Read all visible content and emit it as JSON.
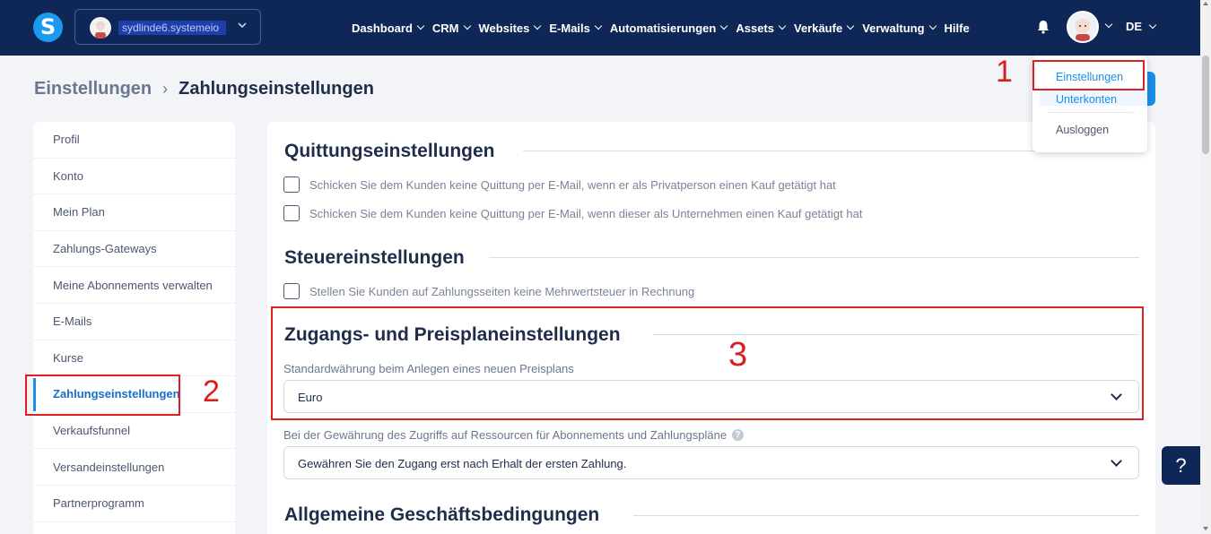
{
  "topbar": {
    "logo_letter": "S",
    "account_name": "sydlinde6.systemeio",
    "nav": [
      {
        "label": "Dashboard"
      },
      {
        "label": "CRM"
      },
      {
        "label": "Websites"
      },
      {
        "label": "E-Mails"
      },
      {
        "label": "Automatisierungen"
      },
      {
        "label": "Assets"
      },
      {
        "label": "Verkäufe"
      },
      {
        "label": "Verwaltung"
      }
    ],
    "help_label": "Hilfe",
    "language": "DE"
  },
  "user_menu": {
    "items": [
      "Einstellungen",
      "Unterkonten",
      "Ausloggen"
    ]
  },
  "breadcrumb": {
    "parent": "Einstellungen",
    "separator": "›",
    "current": "Zahlungseinstellungen"
  },
  "sidebar": {
    "items": [
      "Profil",
      "Konto",
      "Mein Plan",
      "Zahlungs-Gateways",
      "Meine Abonnements verwalten",
      "E-Mails",
      "Kurse",
      "Zahlungseinstellungen",
      "Verkaufsfunnel",
      "Versandeinstellungen",
      "Partnerprogramm"
    ],
    "active_index": 7
  },
  "main": {
    "receipt": {
      "title": "Quittungseinstellungen",
      "option1": "Schicken Sie dem Kunden keine Quittung per E-Mail, wenn er als Privatperson einen Kauf getätigt hat",
      "option2": "Schicken Sie dem Kunden keine Quittung per E-Mail, wenn dieser als Unternehmen einen Kauf getätigt hat"
    },
    "tax": {
      "title": "Steuereinstellungen",
      "option1": "Stellen Sie Kunden auf Zahlungsseiten keine Mehrwertsteuer in Rechnung"
    },
    "access": {
      "title": "Zugangs- und Preisplaneinstellungen",
      "currency_label": "Standardwährung beim Anlegen eines neuen Preisplans",
      "currency_value": "Euro",
      "access_label": "Bei der Gewährung des Zugriffs auf Ressourcen für Abonnements und Zahlungspläne",
      "access_value": "Gewähren Sie den Zugang erst nach Erhalt der ersten Zahlung."
    },
    "terms": {
      "title": "Allgemeine Geschäftsbedingungen"
    }
  },
  "annotations": [
    "1",
    "2",
    "3"
  ],
  "help_button": "?",
  "help_dot": "?",
  "colors": {
    "topbar": "#0f2756",
    "accent": "#1a8ee8",
    "annotation": "#e02020"
  }
}
